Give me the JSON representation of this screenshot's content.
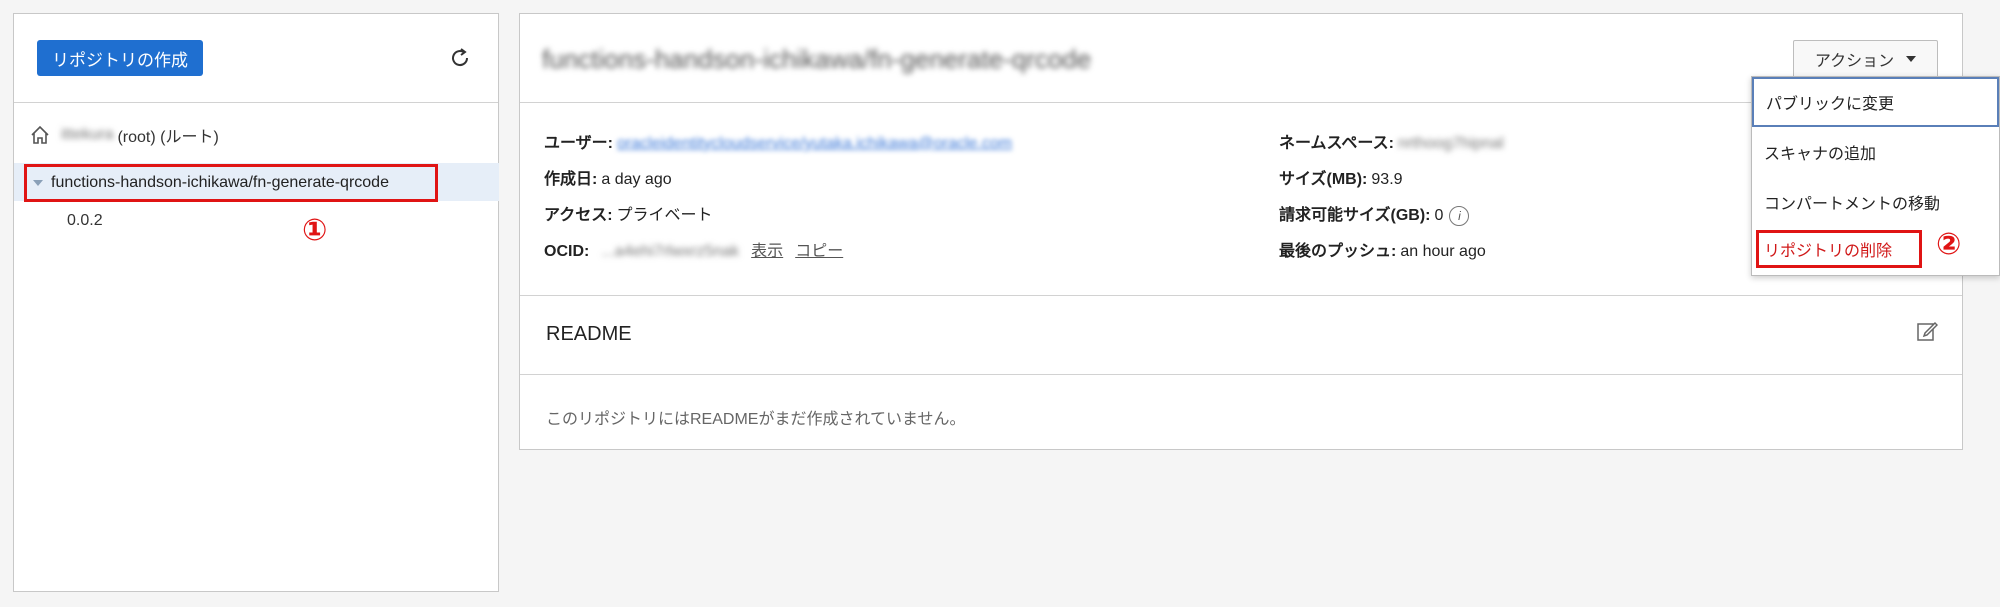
{
  "left": {
    "create_button": "リポジトリの作成",
    "root_blurred": "ittekura",
    "root_label": "(root) (ルート)",
    "repo_name": "functions-handson-ichikawa/fn-generate-qrcode",
    "tag": "0.0.2",
    "annotation": "①"
  },
  "right": {
    "title": "functions-handson-ichikawa/fn-generate-qrcode",
    "actions_label": "アクション",
    "fields": {
      "user_label": "ユーザー:",
      "user_value": "oracleidentitycloudservice/yutaka.ichikawa@oracle.com",
      "created_label": "作成日:",
      "created_value": "a day ago",
      "access_label": "アクセス:",
      "access_value": "プライベート",
      "ocid_label": "OCID:",
      "ocid_value": "...a4ehi7rlwxrz5nak",
      "ocid_show": "表示",
      "ocid_copy": "コピー",
      "namespace_label": "ネームスペース:",
      "namespace_value": "nrthoog7hipnal",
      "size_label": "サイズ(MB):",
      "size_value": "93.9",
      "billable_label": "請求可能サイズ(GB):",
      "billable_value": "0",
      "push_label": "最後のプッシュ:",
      "push_value": "an hour ago"
    },
    "readme_title": "README",
    "readme_empty": "このリポジトリにはREADMEがまだ作成されていません。"
  },
  "menu": {
    "items": [
      "パブリックに変更",
      "スキャナの追加",
      "コンパートメントの移動",
      "リポジトリの削除"
    ],
    "annotation": "②"
  },
  "colors": {
    "primary": "#1f6fd0",
    "highlight": "#e01414",
    "selection": "#e6eef8"
  }
}
